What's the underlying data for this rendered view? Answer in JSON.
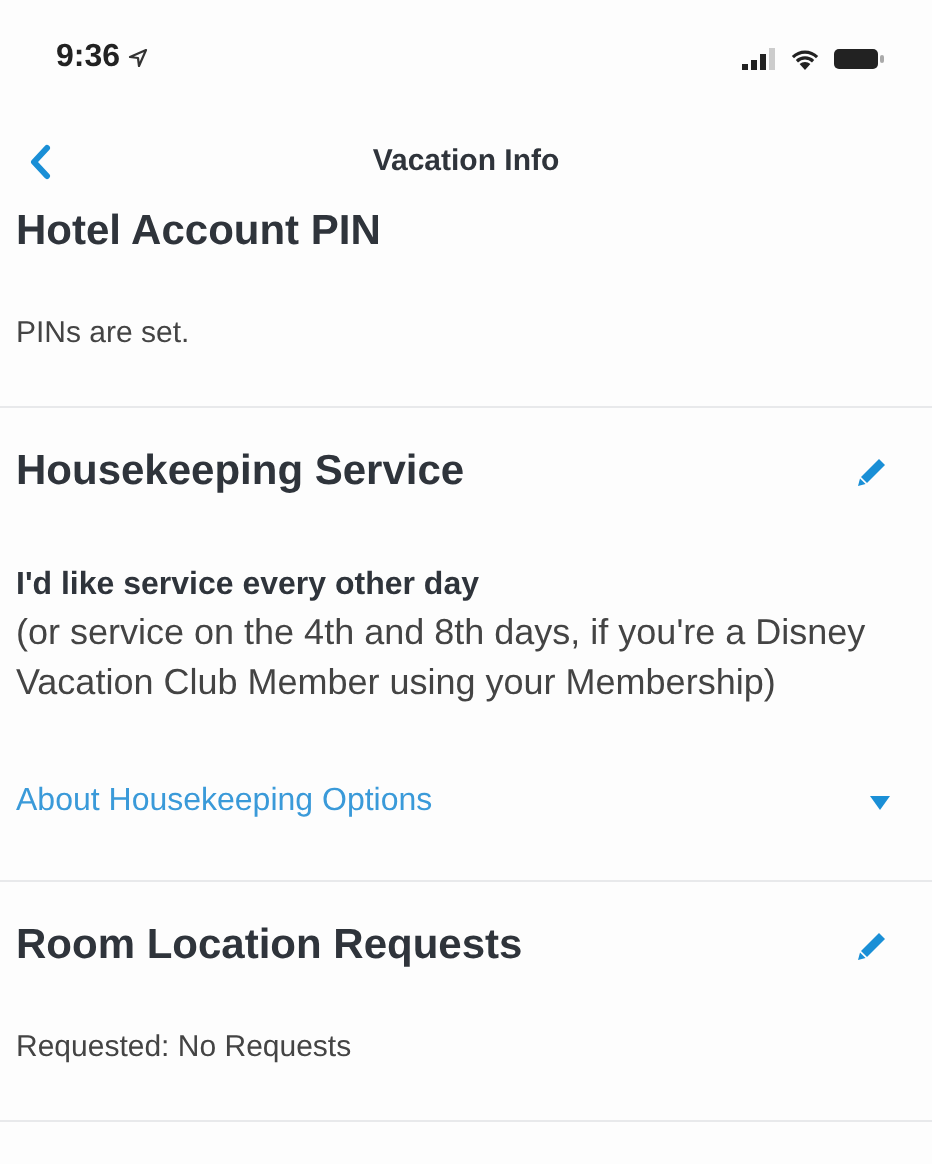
{
  "status_bar": {
    "time": "9:36",
    "location_on": true
  },
  "nav": {
    "title": "Vacation Info"
  },
  "sections": [
    {
      "title": "Hotel Account PIN",
      "editable": false,
      "body": [
        {
          "kind": "text",
          "text": "PINs are set."
        }
      ]
    },
    {
      "title": "Housekeeping Service",
      "editable": true,
      "body": [
        {
          "kind": "strong",
          "text": "I'd like service every other day"
        },
        {
          "kind": "note",
          "text": "(or service on the 4th and 8th days, if you're a Disney Vacation Club Member using your Membership)"
        },
        {
          "kind": "disclosure",
          "text": "About Housekeeping Options",
          "expanded": false
        }
      ]
    },
    {
      "title": "Room Location Requests",
      "editable": true,
      "body": [
        {
          "kind": "text",
          "text": "Requested: No Requests"
        }
      ]
    }
  ]
}
